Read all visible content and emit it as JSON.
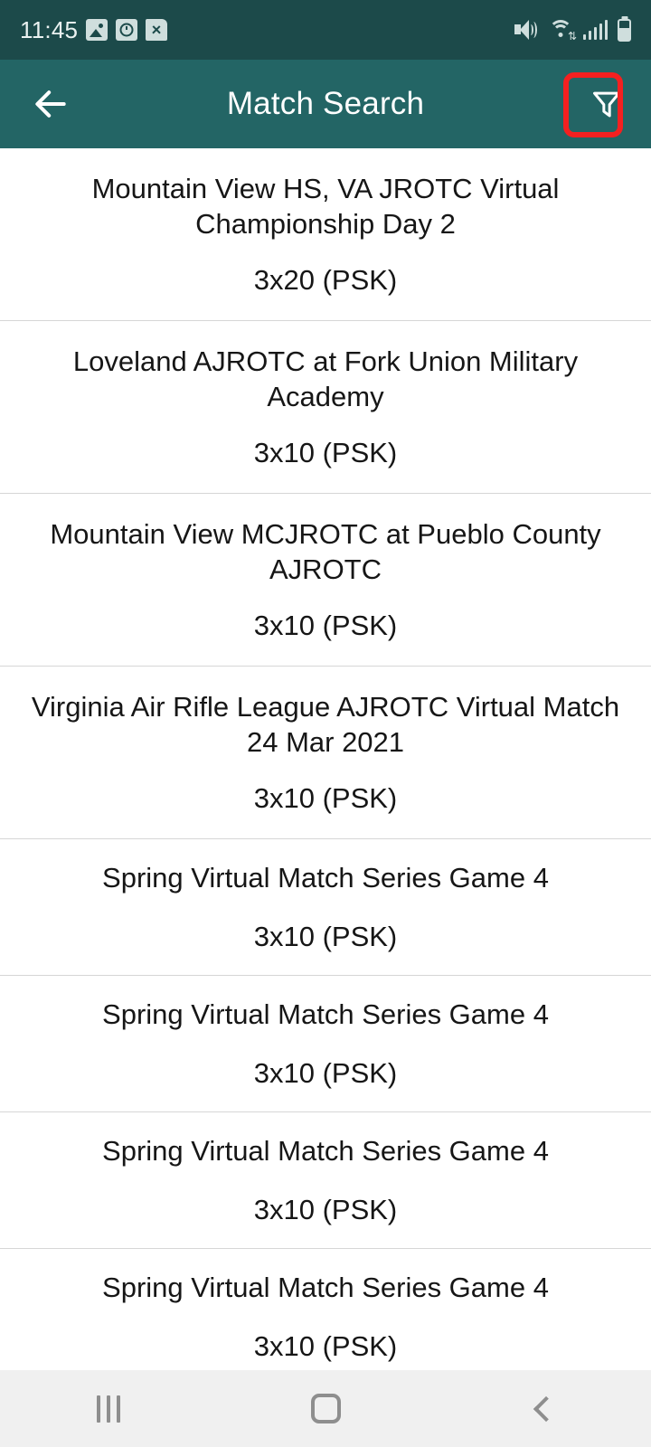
{
  "status_bar": {
    "time": "11:45",
    "left_icons": [
      "image-icon",
      "clock-file-icon",
      "x-file-icon"
    ],
    "right_icons": [
      "mute-vibrate-icon",
      "wifi-icon",
      "cellular-signal-icon",
      "battery-icon"
    ],
    "background_color": "#1c4a4a"
  },
  "app_bar": {
    "title": "Match Search",
    "back_icon": "back-arrow-icon",
    "filter_icon": "filter-funnel-icon",
    "background_color": "#236565",
    "text_color": "#ffffff"
  },
  "annotation": {
    "highlight_color": "#f42020",
    "target": "filter-funnel-icon",
    "shapes": [
      "rounded-rect-highlight",
      "up-arrow-pointer"
    ]
  },
  "match_list": {
    "items": [
      {
        "title": "Mountain View HS, VA JROTC Virtual Championship Day 2",
        "course": "3x20 (PSK)",
        "lines": 2
      },
      {
        "title": "Loveland AJROTC at Fork Union Military Academy",
        "course": "3x10 (PSK)",
        "lines": 2
      },
      {
        "title": "Mountain View MCJROTC at Pueblo County AJROTC",
        "course": "3x10 (PSK)",
        "lines": 2
      },
      {
        "title": "Virginia Air Rifle League AJROTC Virtual Match 24 Mar 2021",
        "course": "3x10 (PSK)",
        "lines": 2
      },
      {
        "title": "Spring Virtual Match Series Game 4",
        "course": "3x10 (PSK)",
        "lines": 1
      },
      {
        "title": "Spring Virtual Match Series Game 4",
        "course": "3x10 (PSK)",
        "lines": 1
      },
      {
        "title": "Spring Virtual Match Series Game 4",
        "course": "3x10 (PSK)",
        "lines": 1
      },
      {
        "title": "Spring Virtual Match Series Game 4",
        "course": "3x10 (PSK)",
        "lines": 1
      }
    ],
    "divider_color": "#d6d6d6",
    "text_color": "#161616"
  },
  "nav_bar": {
    "recents_icon": "recents-icon",
    "home_icon": "home-icon",
    "back_icon": "nav-back-icon",
    "background_color": "#f0f0f0"
  }
}
